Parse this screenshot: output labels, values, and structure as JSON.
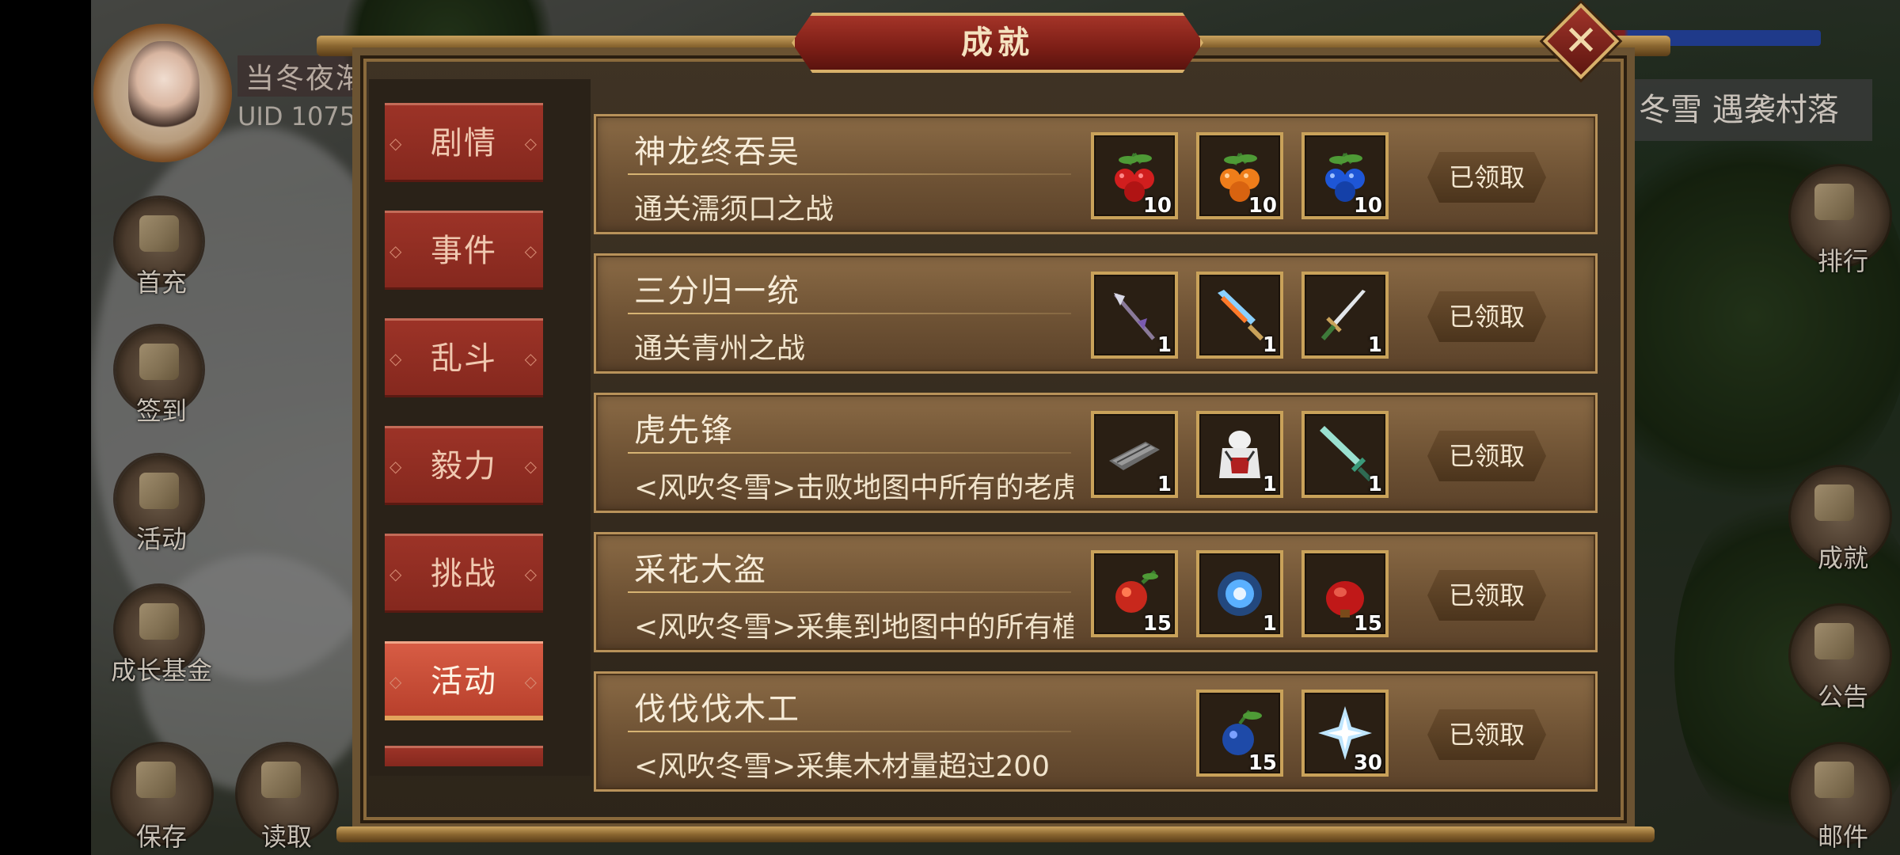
{
  "hud": {
    "player_name": "当冬夜渐",
    "player_uid": "UID  1075",
    "left_buttons": [
      {
        "label": "首充"
      },
      {
        "label": "签到"
      },
      {
        "label": "活动"
      },
      {
        "label": "成长基金"
      }
    ],
    "bottom_buttons": [
      {
        "label": "保存"
      },
      {
        "label": "读取"
      }
    ],
    "location": "冬雪 遇袭村落",
    "right_buttons": [
      {
        "label": "排行"
      },
      {
        "label": "成就"
      },
      {
        "label": "公告"
      },
      {
        "label": "邮件"
      }
    ]
  },
  "panel": {
    "title": "成就",
    "close_label": "✕",
    "tabs": [
      {
        "label": "剧情",
        "active": false
      },
      {
        "label": "事件",
        "active": false
      },
      {
        "label": "乱斗",
        "active": false
      },
      {
        "label": "毅力",
        "active": false
      },
      {
        "label": "挑战",
        "active": false
      },
      {
        "label": "活动",
        "active": true
      }
    ],
    "achievements": [
      {
        "title": "神龙终吞吴",
        "desc": "通关濡须口之战",
        "button": "已领取",
        "rewards": [
          {
            "icon": "red-berry-icon",
            "qty": "10"
          },
          {
            "icon": "orange-berry-icon",
            "qty": "10"
          },
          {
            "icon": "blue-berry-icon",
            "qty": "10"
          }
        ]
      },
      {
        "title": "三分归一统",
        "desc": "通关青州之战",
        "button": "已领取",
        "rewards": [
          {
            "icon": "halberd-icon",
            "qty": "1"
          },
          {
            "icon": "flame-blade-icon",
            "qty": "1"
          },
          {
            "icon": "green-sword-icon",
            "qty": "1"
          }
        ]
      },
      {
        "title": "虎先锋",
        "desc": "<风吹冬雪>击败地图中所有的老虎",
        "button": "已领取",
        "rewards": [
          {
            "icon": "scroll-case-icon",
            "qty": "1"
          },
          {
            "icon": "tiger-armor-icon",
            "qty": "1"
          },
          {
            "icon": "jade-sword-icon",
            "qty": "1"
          }
        ]
      },
      {
        "title": "采花大盗",
        "desc": "<风吹冬雪>采集到地图中的所有植物",
        "button": "已领取",
        "rewards": [
          {
            "icon": "red-fruit-icon",
            "qty": "15"
          },
          {
            "icon": "blue-orb-icon",
            "qty": "1"
          },
          {
            "icon": "red-gourd-icon",
            "qty": "15"
          }
        ]
      },
      {
        "title": "伐伐伐木工",
        "desc": "<风吹冬雪>采集木材量超过200",
        "button": "已领取",
        "rewards": [
          {
            "icon": "blue-plum-icon",
            "qty": "15"
          },
          {
            "icon": "ice-crystal-icon",
            "qty": "30"
          }
        ]
      }
    ]
  }
}
